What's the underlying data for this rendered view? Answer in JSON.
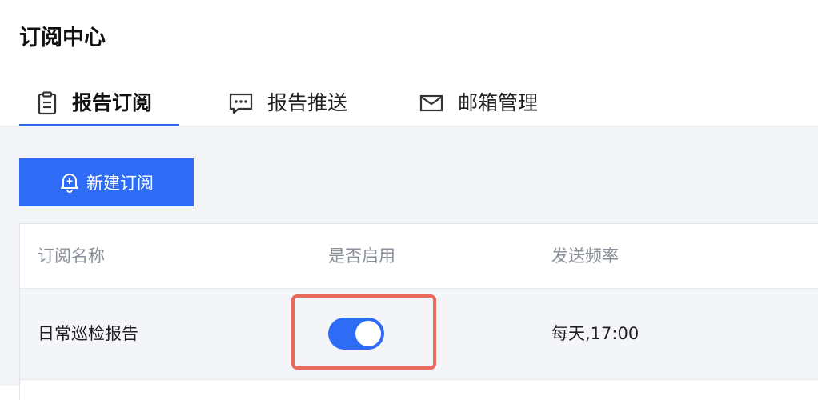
{
  "page": {
    "title": "订阅中心"
  },
  "tabs": [
    {
      "label": "报告订阅",
      "icon": "clipboard-icon",
      "active": true
    },
    {
      "label": "报告推送",
      "icon": "message-icon",
      "active": false
    },
    {
      "label": "邮箱管理",
      "icon": "mail-icon",
      "active": false
    }
  ],
  "toolbar": {
    "new_label": "新建订阅",
    "new_icon": "bell-plus-icon"
  },
  "table": {
    "columns": [
      "订阅名称",
      "是否启用",
      "发送频率"
    ],
    "rows": [
      {
        "name": "日常巡检报告",
        "enabled": true,
        "frequency": "每天,17:00"
      }
    ]
  },
  "colors": {
    "accent": "#2f6cf5",
    "highlight": "#e86a5c",
    "content_bg": "#f3f4f7"
  }
}
